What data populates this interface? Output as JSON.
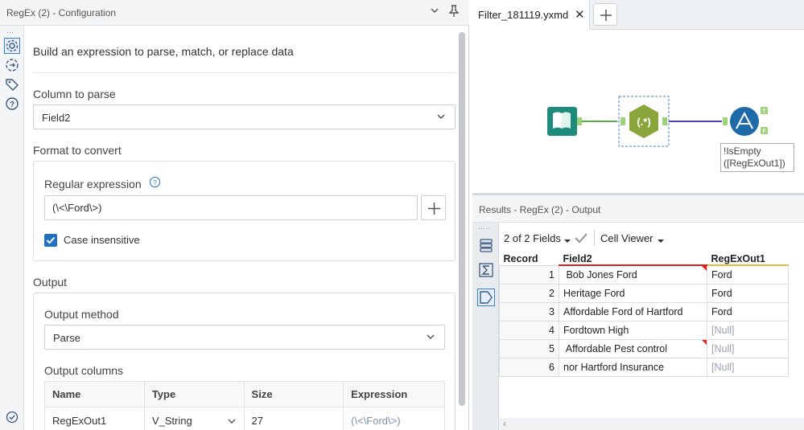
{
  "config_panel": {
    "title": "RegEx (2) - Configuration",
    "description": "Build an expression to parse, match, or replace data",
    "column_to_parse": {
      "label": "Column to parse",
      "value": "Field2"
    },
    "format_to_convert": {
      "label": "Format to convert",
      "regular_expression_label": "Regular expression",
      "regular_expression_value": "(\\<\\Ford\\>)",
      "case_insensitive_label": "Case insensitive",
      "case_insensitive_checked": true
    },
    "output": {
      "label": "Output",
      "method_label": "Output method",
      "method_value": "Parse",
      "columns_label": "Output columns",
      "columns_headers": [
        "Name",
        "Type",
        "Size",
        "Expression"
      ],
      "columns_rows": [
        {
          "name": "RegExOut1",
          "type": "V_String",
          "size": "27",
          "expression": "(\\<\\Ford\\>)"
        }
      ]
    }
  },
  "canvas": {
    "tab_label": "Filter_181119.yxmd",
    "close_glyph": "✕",
    "add_glyph": "+",
    "filter_annotation_line1": "!IsEmpty",
    "filter_annotation_line2": "([RegExOut1])",
    "filter_true_label": "T",
    "filter_false_label": "F",
    "regex_tool_label": "(.*)"
  },
  "results": {
    "title": "Results - RegEx (2) - Output",
    "fields_selector": "2 of 2 Fields",
    "cell_viewer": "Cell Viewer",
    "headers": [
      "Record",
      "Field2",
      "RegExOut1"
    ],
    "rows": [
      {
        "record": "1",
        "field2": " Bob Jones Ford",
        "out": "Ford",
        "flag": true
      },
      {
        "record": "2",
        "field2": "Heritage Ford",
        "out": "Ford",
        "flag": false
      },
      {
        "record": "3",
        "field2": "Affordable Ford of Hartford",
        "out": "Ford",
        "flag": false
      },
      {
        "record": "4",
        "field2": "Fordtown High",
        "out": "[Null]",
        "flag": false
      },
      {
        "record": "5",
        "field2": " Affordable Pest control",
        "out": "[Null]",
        "flag": true
      },
      {
        "record": "6",
        "field2": "nor Hartford Insurance",
        "out": "[Null]",
        "flag": false
      }
    ]
  },
  "colors": {
    "accent": "#1f6fc5",
    "regex_tool": "#8aa63a",
    "input_tool": "#1f8b7d",
    "filter_tool": "#1e6aa8",
    "field2_underline": "#e0201b",
    "out_underline": "#e9b93a"
  }
}
